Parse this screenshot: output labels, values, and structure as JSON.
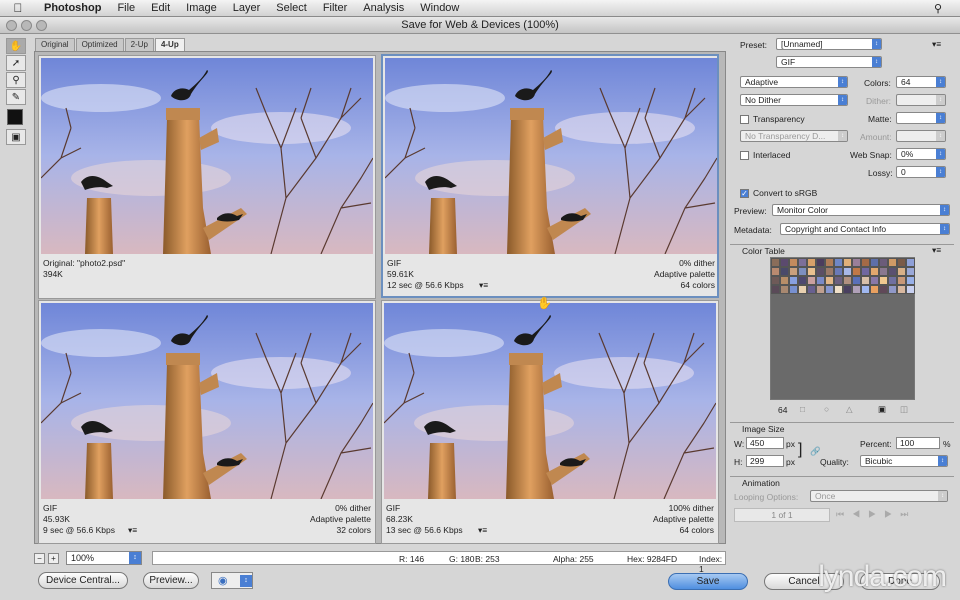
{
  "menubar": {
    "apple": "",
    "app": "Photoshop",
    "items": [
      "File",
      "Edit",
      "Image",
      "Layer",
      "Select",
      "Filter",
      "Analysis",
      "Window"
    ]
  },
  "window": {
    "title": "Save for Web & Devices (100%)"
  },
  "tabs": [
    "Original",
    "Optimized",
    "2-Up",
    "4-Up"
  ],
  "panes": [
    {
      "l1": "Original: \"photo2.psd\"",
      "l2": "394K",
      "l3": "",
      "r1": "",
      "r2": "",
      "r3": ""
    },
    {
      "l1": "GIF",
      "l2": "59.61K",
      "l3": "12 sec @ 56.6 Kbps",
      "r1": "0% dither",
      "r2": "Adaptive palette",
      "r3": "64 colors"
    },
    {
      "l1": "GIF",
      "l2": "45.93K",
      "l3": "9 sec @ 56.6 Kbps",
      "r1": "0% dither",
      "r2": "Adaptive palette",
      "r3": "32 colors"
    },
    {
      "l1": "GIF",
      "l2": "68.23K",
      "l3": "13 sec @ 56.6 Kbps",
      "r1": "100% dither",
      "r2": "Adaptive palette",
      "r3": "64 colors"
    }
  ],
  "bottom": {
    "zoom": "100%",
    "r": "R: 146",
    "g": "G: 180",
    "b": "B: 253",
    "alpha": "Alpha: 255",
    "hex": "Hex: 9284FD",
    "index": "Index: 1"
  },
  "buttons": {
    "device": "Device Central...",
    "preview": "Preview...",
    "save": "Save",
    "cancel": "Cancel",
    "done": "Done"
  },
  "panel": {
    "preset_label": "Preset:",
    "preset": "[Unnamed]",
    "format": "GIF",
    "reduction": "Adaptive",
    "dither_algo": "No Dither",
    "colors_label": "Colors:",
    "colors": "64",
    "dither_label": "Dither:",
    "matte_label": "Matte:",
    "amount_label": "Amount:",
    "transparency": "Transparency",
    "trans_dither": "No Transparency D...",
    "interlaced": "Interlaced",
    "websnap_label": "Web Snap:",
    "websnap": "0%",
    "lossy_label": "Lossy:",
    "lossy": "0",
    "srgb": "Convert to sRGB",
    "preview_label": "Preview:",
    "preview": "Monitor Color",
    "metadata_label": "Metadata:",
    "metadata": "Copyright and Contact Info",
    "color_table": "Color Table",
    "color_count": "64",
    "image_size": "Image Size",
    "w_label": "W:",
    "w": "450",
    "h_label": "H:",
    "h": "299",
    "px": "px",
    "percent_label": "Percent:",
    "percent": "100",
    "pct": "%",
    "quality_label": "Quality:",
    "quality": "Bicubic",
    "animation": "Animation",
    "looping_label": "Looping Options:",
    "looping": "Once",
    "frame": "1 of 1"
  },
  "watermark": "lynda.com",
  "palette": [
    "#8a6d5a",
    "#5b4a6e",
    "#c28a5e",
    "#7c6f9a",
    "#d7a06a",
    "#4c3d5e",
    "#b07c58",
    "#6f87c7",
    "#e0b07a",
    "#9a7f9a",
    "#a36a46",
    "#5e6fa8",
    "#6b5c7a",
    "#d09a66",
    "#7a5a48",
    "#8fa0d8",
    "#b98a70",
    "#4a4a6a",
    "#c9a07e",
    "#7d8fc0",
    "#e8c090",
    "#5c4f66",
    "#9c7a68",
    "#6a7ab8",
    "#a8b8e8",
    "#c07848",
    "#7068a0",
    "#e2a86e",
    "#8a7890",
    "#5a5070",
    "#d8b088",
    "#9aa8d8",
    "#6e5a58",
    "#b88e68",
    "#88a0e0",
    "#4e4870",
    "#caa0a0",
    "#7a8ac8",
    "#e4b888",
    "#6c6080",
    "#b09080",
    "#5a70b8",
    "#d8c0a8",
    "#8878a8",
    "#f0c890",
    "#7070a0",
    "#c89878",
    "#98b0e8",
    "#5a4a58",
    "#a88870",
    "#7890d0",
    "#e8d0b0",
    "#686090",
    "#c0a090",
    "#8898d0",
    "#f0e0c8",
    "#4a4060",
    "#b0a0b8",
    "#a0b8f0",
    "#e8a060",
    "#604858",
    "#9098c8",
    "#d8b8a0",
    "#c8d0f0"
  ]
}
